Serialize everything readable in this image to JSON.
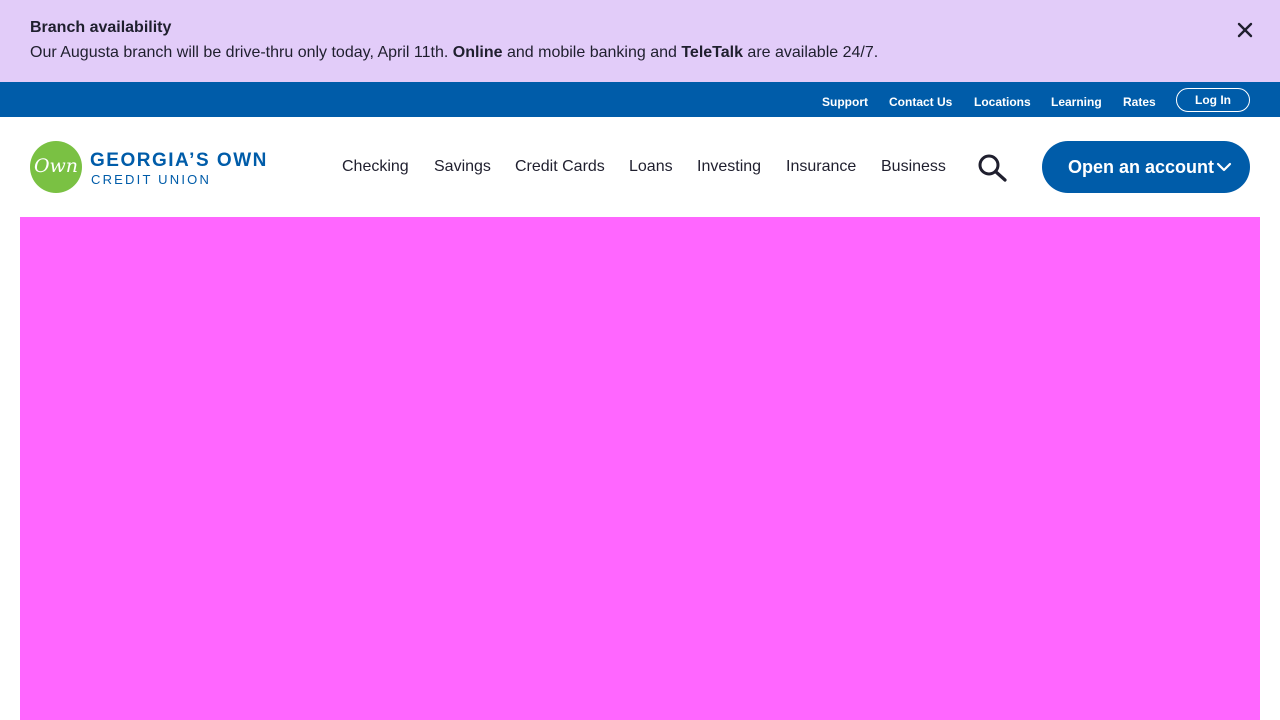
{
  "alert": {
    "title": "Branch availability",
    "message_part1": "Our Augusta branch will be drive-thru only today, April 11th. ",
    "message_bold1": "Online",
    "message_part2": " and mobile banking and ",
    "message_bold2": "TeleTalk",
    "message_part3": " are available 24/7.",
    "close_icon": "close-icon"
  },
  "utility_nav": {
    "links": [
      "Support",
      "Contact Us",
      "Locations",
      "Learning",
      "Rates"
    ],
    "login_label": "Log In"
  },
  "brand": {
    "logo_mark": "Own",
    "name": "GEORGIA’S OWN",
    "subname": "CREDIT UNION"
  },
  "main_nav": {
    "items": [
      "Checking",
      "Savings",
      "Credit Cards",
      "Loans",
      "Investing",
      "Insurance",
      "Business"
    ],
    "search_icon": "search-icon"
  },
  "cta": {
    "label": "Open an account",
    "icon": "chevron-down-icon"
  },
  "colors": {
    "alert_bg": "#e2ccf9",
    "brand_blue": "#005ca9",
    "logo_green": "#7ac143",
    "hero_placeholder": "#ff66ff"
  }
}
